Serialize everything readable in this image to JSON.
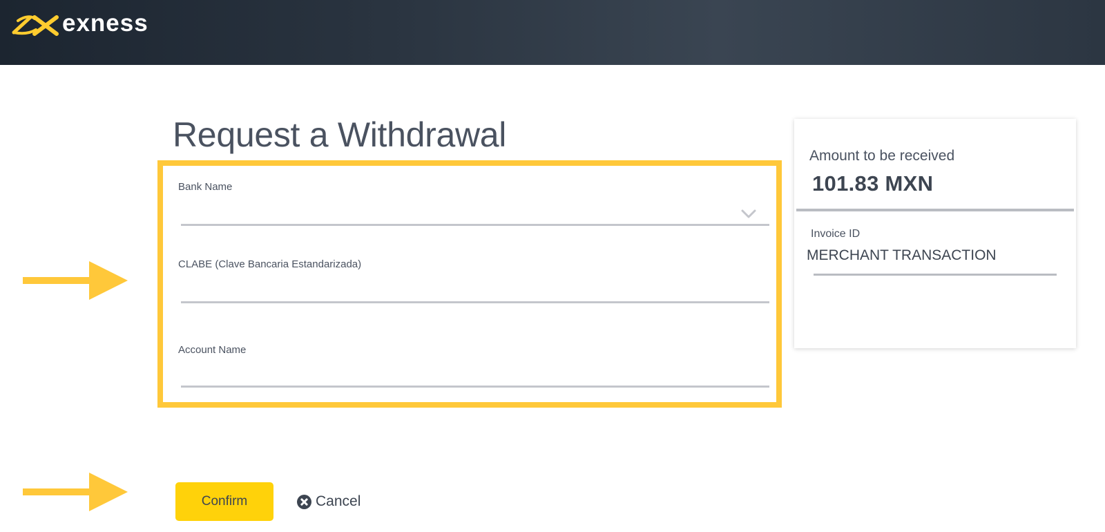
{
  "header": {
    "brand_name": "exness",
    "logo_icon": "exness-logo-icon",
    "brand_color": "#ffcc2f"
  },
  "page": {
    "title": "Request a Withdrawal"
  },
  "form": {
    "highlight_color": "#ffc83a",
    "fields": [
      {
        "label": "Bank Name",
        "type": "select",
        "value": "",
        "icon": "chevron-down-icon"
      },
      {
        "label": "CLABE (Clave Bancaria Estandarizada)",
        "type": "text",
        "value": ""
      },
      {
        "label": "Account Name",
        "type": "text",
        "value": ""
      }
    ]
  },
  "summary": {
    "amount_label": "Amount to be received",
    "amount_value": "101.83 MXN",
    "invoice_label": "Invoice ID",
    "invoice_value": "MERCHANT TRANSACTION"
  },
  "actions": {
    "confirm_label": "Confirm",
    "confirm_color": "#ffd20a",
    "cancel_label": "Cancel",
    "cancel_icon": "close-circle-icon"
  },
  "annotations": {
    "arrow_color": "#ffc83a",
    "arrow_icon": "arrow-right-icon"
  }
}
